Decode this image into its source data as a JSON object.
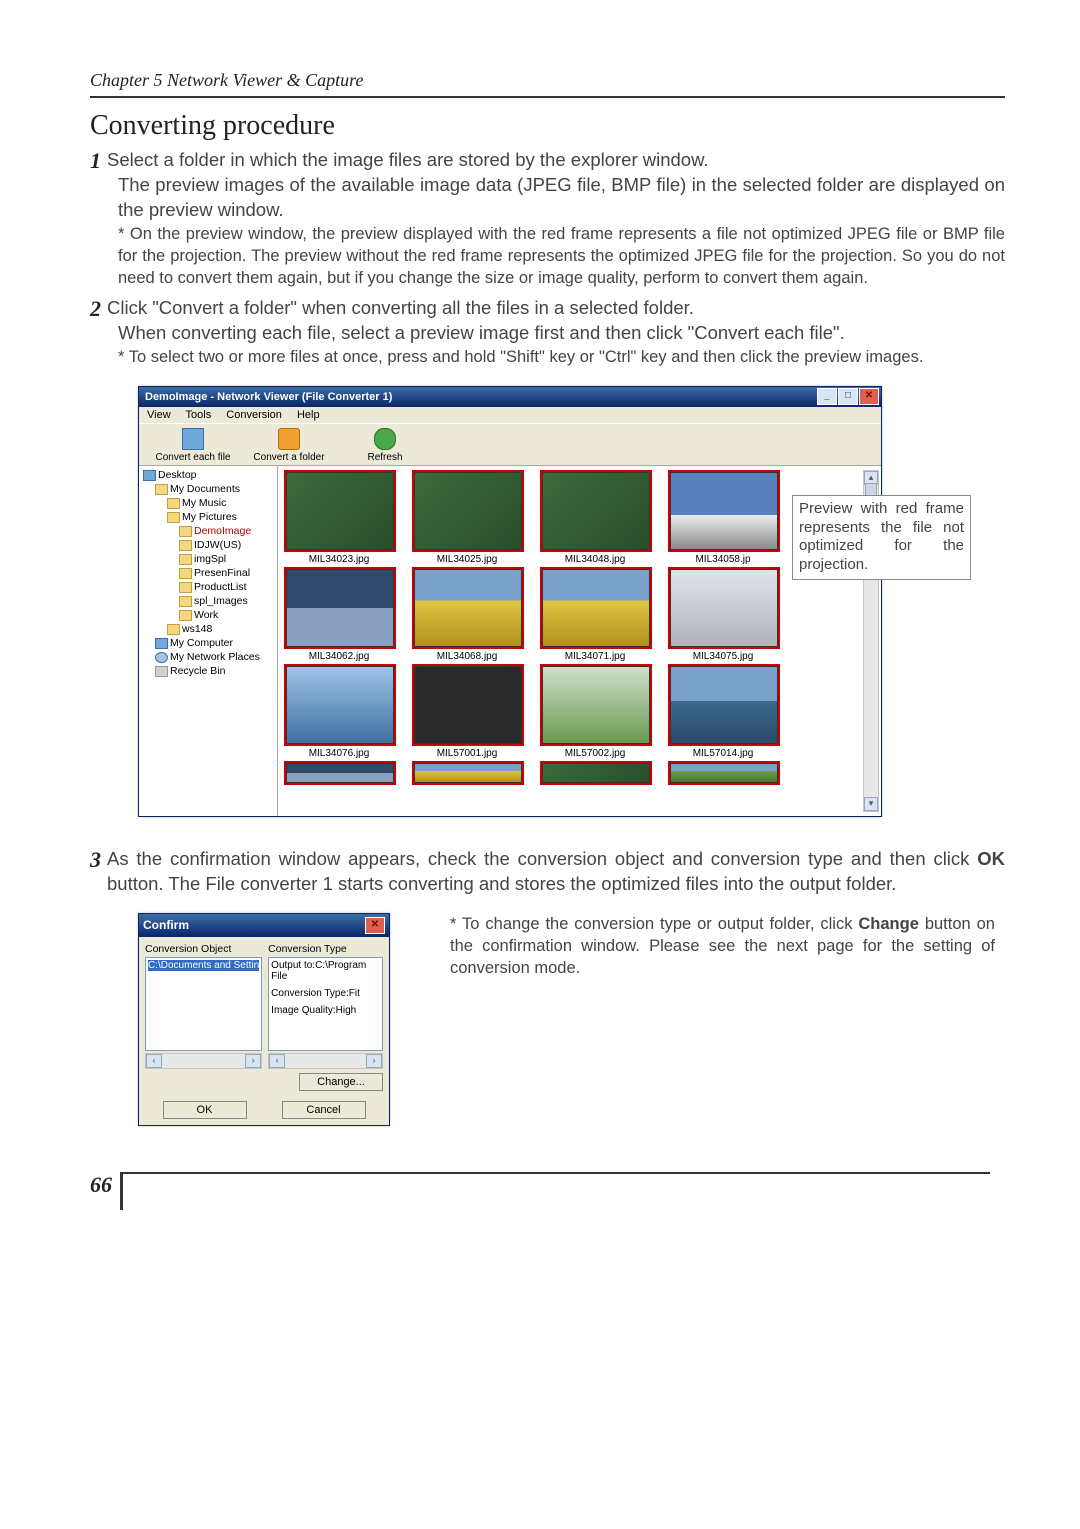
{
  "chapter_header": "Chapter 5 Network Viewer & Capture",
  "section_title": "Converting procedure",
  "step1": {
    "num": "1",
    "intro": "Select a folder in which the image files are stored by the explorer window.",
    "para": "The preview images of the available image data (JPEG file, BMP file) in the selected folder are displayed on the preview window.",
    "note": "* On the preview window, the preview displayed with the red frame represents a file not optimized JPEG file or BMP file for the projection. The preview without the red frame represents the optimized JPEG file for the projection. So you do not need to convert them again, but if you change the size or image quality, perform to convert them again."
  },
  "step2": {
    "num": "2",
    "intro": "Click \"Convert a folder\" when converting all the files in a selected folder.",
    "para": "When converting each file, select a preview image first and then click \"Convert each file\".",
    "note": "* To select two or more files at once, press and hold \"Shift\" key or \"Ctrl\" key and then click the preview images."
  },
  "app": {
    "title": "DemoImage - Network Viewer (File Converter 1)",
    "menus": [
      "View",
      "Tools",
      "Conversion",
      "Help"
    ],
    "tools": [
      {
        "name": "convert-each-file",
        "label": "Convert each file"
      },
      {
        "name": "convert-a-folder",
        "label": "Convert a folder"
      },
      {
        "name": "refresh",
        "label": "Refresh"
      }
    ],
    "tree": [
      {
        "i": 0,
        "icon": "desk",
        "label": "Desktop"
      },
      {
        "i": 1,
        "icon": "fld",
        "label": "My Documents"
      },
      {
        "i": 2,
        "icon": "fld",
        "label": "My Music"
      },
      {
        "i": 2,
        "icon": "fld",
        "label": "My Pictures"
      },
      {
        "i": 3,
        "icon": "fld",
        "label": "DemoImage",
        "red": true
      },
      {
        "i": 3,
        "icon": "fld",
        "label": "IDJW(US)"
      },
      {
        "i": 3,
        "icon": "fld",
        "label": "imgSpl"
      },
      {
        "i": 3,
        "icon": "fld",
        "label": "PresenFinal"
      },
      {
        "i": 3,
        "icon": "fld",
        "label": "ProductList"
      },
      {
        "i": 3,
        "icon": "fld",
        "label": "spl_Images"
      },
      {
        "i": 3,
        "icon": "fld",
        "label": "Work"
      },
      {
        "i": 2,
        "icon": "fld",
        "label": "ws148"
      },
      {
        "i": 1,
        "icon": "desk",
        "label": "My Computer"
      },
      {
        "i": 1,
        "icon": "net",
        "label": "My Network Places"
      },
      {
        "i": 1,
        "icon": "bin",
        "label": "Recycle Bin"
      }
    ],
    "thumbs": [
      [
        {
          "cls": "sports notopt",
          "name": "MIL34023.jpg"
        },
        {
          "cls": "sports notopt",
          "name": "MIL34025.jpg"
        },
        {
          "cls": "sports notopt",
          "name": "MIL34048.jpg"
        },
        {
          "cls": "mtn notopt",
          "name": "MIL34058.jp"
        }
      ],
      [
        {
          "cls": "boat notopt",
          "name": "MIL34062.jpg"
        },
        {
          "cls": "flags notopt",
          "name": "MIL34068.jpg"
        },
        {
          "cls": "flags notopt",
          "name": "MIL34071.jpg"
        },
        {
          "cls": "cycling notopt",
          "name": "MIL34075.jpg"
        }
      ],
      [
        {
          "cls": "ski notopt",
          "name": "MIL34076.jpg"
        },
        {
          "cls": "dark notopt",
          "name": "MIL57001.jpg"
        },
        {
          "cls": "sprout notopt",
          "name": "MIL57002.jpg"
        },
        {
          "cls": "lake notopt",
          "name": "MIL57014.jpg"
        }
      ]
    ],
    "callout": "Preview with red frame represents the file not optimized for the projection."
  },
  "step3": {
    "num": "3",
    "intro_pre": "As the confirmation window appears, check the conversion object and conversion type and then click ",
    "ok": "OK",
    "intro_post": " button. The File converter 1 starts converting and stores the optimized files into the output folder.",
    "note_pre": "* To change the conversion type or output folder, click ",
    "change": "Change",
    "note_post": " button on the confirmation window. Please see  the next page for the setting of conversion mode."
  },
  "dlg": {
    "title": "Confirm",
    "col_obj": "Conversion Object",
    "col_type": "Conversion Type",
    "obj_path": "C:\\Documents and Settin",
    "type_output": "Output to:C:\\Program File",
    "type_conv": "Conversion Type:Fit",
    "type_qual": "Image Quality:High",
    "btn_change": "Change...",
    "btn_ok": "OK",
    "btn_cancel": "Cancel"
  },
  "page": "66"
}
